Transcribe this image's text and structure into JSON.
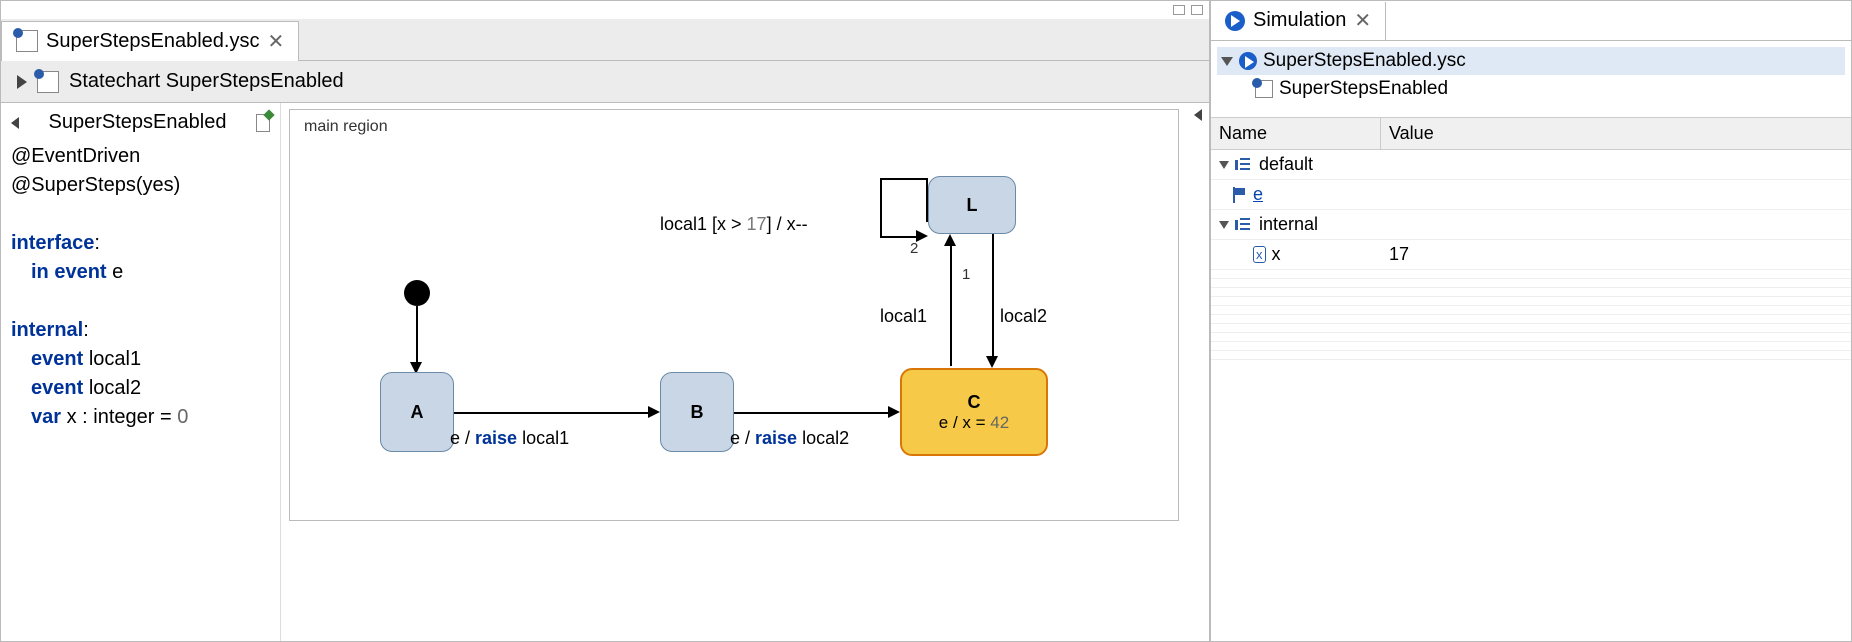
{
  "editor": {
    "tab_label": "SuperStepsEnabled.ysc",
    "tab_close": "✕",
    "breadcrumb": "Statechart SuperStepsEnabled",
    "def_header": "SuperStepsEnabled",
    "annotations": {
      "event_driven": "@EventDriven",
      "super_steps": "@SuperSteps(yes)"
    },
    "interface_kw": "interface",
    "in_kw": "in",
    "event_kw": "event",
    "e_name": "e",
    "internal_kw": "internal",
    "local1_name": "local1",
    "local2_name": "local2",
    "var_kw": "var",
    "var_name": "x",
    "var_type": "integer",
    "var_init": "0"
  },
  "diagram": {
    "region_label": "main region",
    "state_A": "A",
    "state_B": "B",
    "state_C": "C",
    "state_C_action_pre": "e / x = ",
    "state_C_action_val": "42",
    "state_L": "L",
    "trans_AB_pre": "e / ",
    "trans_AB_kw": "raise",
    "trans_AB_post": " local1",
    "trans_BC_pre": "e / ",
    "trans_BC_kw": "raise",
    "trans_BC_post": " local2",
    "trans_CL": "local1",
    "trans_LC": "local2",
    "trans_LL_pre": "local1 [x > ",
    "trans_LL_num": "17",
    "trans_LL_post": "] / x--",
    "prio1": "1",
    "prio2": "2"
  },
  "sim": {
    "tab_label": "Simulation",
    "tab_close": "✕",
    "tree_root": "SuperStepsEnabled.ysc",
    "tree_child": "SuperStepsEnabled",
    "table": {
      "col_name": "Name",
      "col_value": "Value",
      "scope_default": "default",
      "event_e": "e",
      "scope_internal": "internal",
      "var_x": "x",
      "var_x_val": "17"
    }
  }
}
